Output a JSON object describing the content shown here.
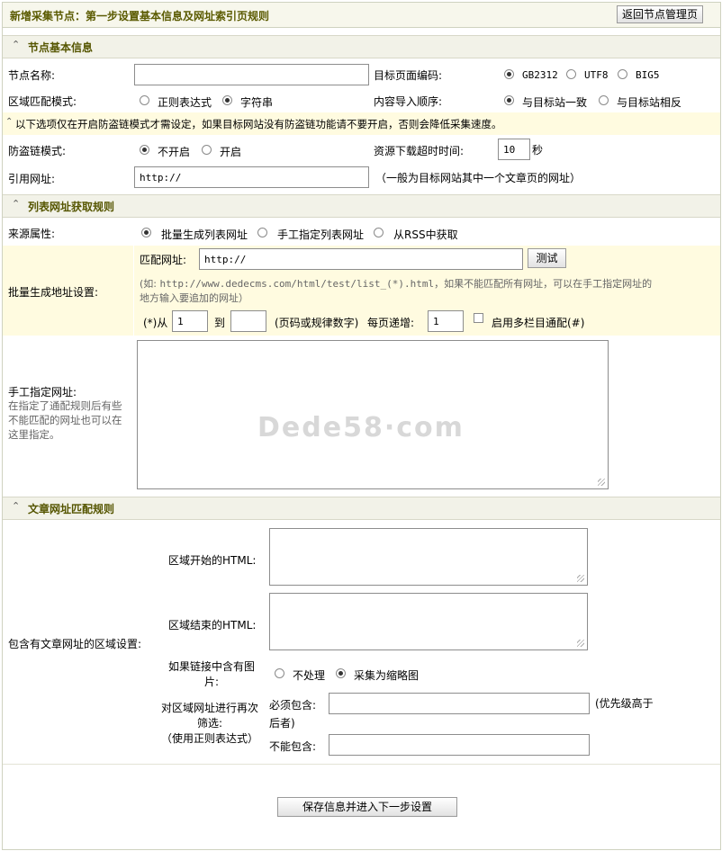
{
  "header": {
    "title": "新增采集节点：第一步设置基本信息及网址索引页规则",
    "back_button": "返回节点管理页"
  },
  "sections": {
    "basic": "节点基本信息",
    "list_rules": "列表网址获取规则",
    "article_rules": "文章网址匹配规则"
  },
  "basic": {
    "node_name_label": "节点名称:",
    "node_name_value": "",
    "encoding_label": "目标页面编码:",
    "encoding_options": [
      "GB2312",
      "UTF8",
      "BIG5"
    ],
    "encoding_selected": "GB2312",
    "match_mode_label": "区域匹配模式:",
    "match_mode_options": [
      "正则表达式",
      "字符串"
    ],
    "match_mode_selected": "字符串",
    "import_order_label": "内容导入顺序:",
    "import_order_options": [
      "与目标站一致",
      "与目标站相反"
    ],
    "import_order_selected": "与目标站一致",
    "notice": "以下选项仅在开启防盗链模式才需设定，如果目标网站没有防盗链功能请不要开启，否则会降低采集速度。",
    "anti_leech_label": "防盗链模式:",
    "anti_leech_options": [
      "不开启",
      "开启"
    ],
    "anti_leech_selected": "不开启",
    "timeout_label": "资源下载超时时间:",
    "timeout_value": "10",
    "timeout_unit": "秒",
    "referer_label": "引用网址:",
    "referer_value": "http://",
    "referer_hint": "（一般为目标网站其中一个文章页的网址）"
  },
  "list": {
    "source_label": "来源属性:",
    "source_options": [
      "批量生成列表网址",
      "手工指定列表网址",
      "从RSS中获取"
    ],
    "source_selected": "批量生成列表网址",
    "batch_label": "批量生成地址设置:",
    "match_url_label": "匹配网址:",
    "match_url_value": "http://",
    "test_button": "测试",
    "example_prefix": "(如:",
    "example_url": "http://www.dedecms.com/html/test/list_(*).html",
    "example_suffix": "，如果不能匹配所有网址，可以在手工指定网址的",
    "example_line2": "地方输入要追加的网址）",
    "from_label": "(*)从",
    "from_value": "1",
    "to_label": "到",
    "to_value": "",
    "page_hint": "(页码或规律数字)",
    "step_label": "每页递增:",
    "step_value": "1",
    "multi_label": "启用多栏目通配(#)",
    "multi_checked": false,
    "manual_label": "手工指定网址:",
    "manual_hint_lines": [
      "在指定了通配规则后有些",
      "不能匹配的网址也可以在",
      "这里指定。"
    ],
    "manual_value": ""
  },
  "article": {
    "area_label": "包含有文章网址的区域设置:",
    "start_label": "区域开始的HTML:",
    "end_label": "区域结束的HTML:",
    "image_label_lines": [
      "如果链接中含有图",
      "片:"
    ],
    "image_options": [
      "不处理",
      "采集为缩略图"
    ],
    "image_selected": "采集为缩略图",
    "filter_label_lines": [
      "对区域网址进行再次",
      "筛选:",
      "（使用正则表达式）"
    ],
    "must_contain_label": "必须包含:",
    "must_contain_value": "",
    "priority_hint_lines": [
      "(优先级高于",
      "后者)"
    ],
    "not_contain_label": "不能包含:",
    "not_contain_value": ""
  },
  "footer": {
    "submit_button": "保存信息并进入下一步设置"
  },
  "watermark": "Dede58·com"
}
